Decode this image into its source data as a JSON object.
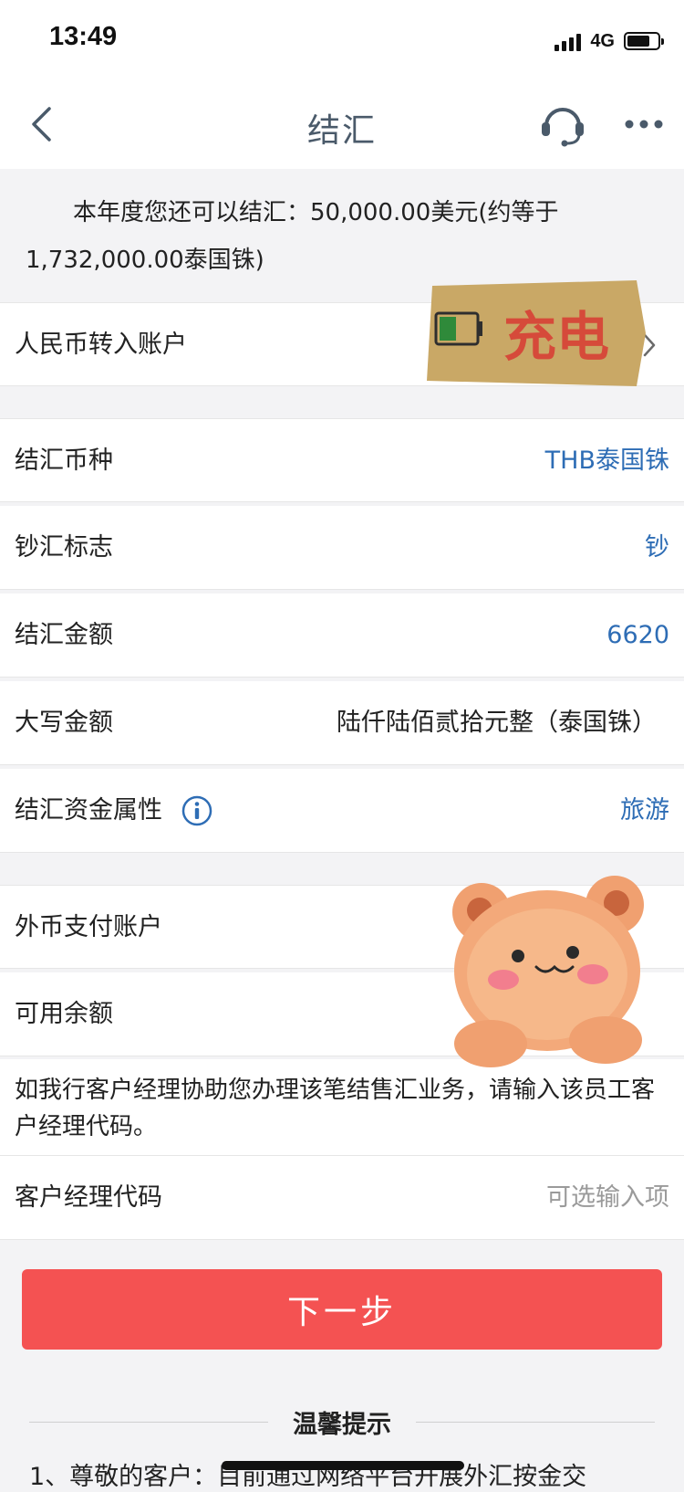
{
  "status": {
    "time": "13:49",
    "network": "4G"
  },
  "nav": {
    "title": "结汇",
    "back_icon": "chevron-left-icon",
    "support_icon": "headset-icon",
    "more_icon": "more-horizontal-icon"
  },
  "quota": {
    "text": "本年度您还可以结汇：50,000.00美元(约等于1,732,000.00泰国铢)"
  },
  "account": {
    "label": "人民币转入账户"
  },
  "form": {
    "currency": {
      "label": "结汇币种",
      "value": "THB泰国铢"
    },
    "cash_flag": {
      "label": "钞汇标志",
      "value": "钞"
    },
    "amount": {
      "label": "结汇金额",
      "value": "6620"
    },
    "amount_words": {
      "label": "大写金额",
      "value": "陆仟陆佰贰拾元整（泰国铢）"
    },
    "purpose": {
      "label": "结汇资金属性",
      "value": "旅游"
    }
  },
  "payment": {
    "account_label": "外币支付账户",
    "balance_label": "可用余额"
  },
  "manager": {
    "note": "如我行客户经理协助您办理该笔结售汇业务，请输入该员工客户经理代码。",
    "code_label": "客户经理代码",
    "code_placeholder": "可选输入项"
  },
  "actions": {
    "next_label": "下一步"
  },
  "tips": {
    "title": "温馨提示",
    "first_line": "1、尊敬的客户：目前通过网络平台开展外汇按金交"
  },
  "stickers": {
    "charge_text": "充电",
    "charge_icon": "battery-icon",
    "bear_icon": "teddy-bear-sticker"
  },
  "colors": {
    "accent_blue": "#2e6db5",
    "primary_red": "#f45252",
    "page_bg": "#f3f3f5"
  }
}
